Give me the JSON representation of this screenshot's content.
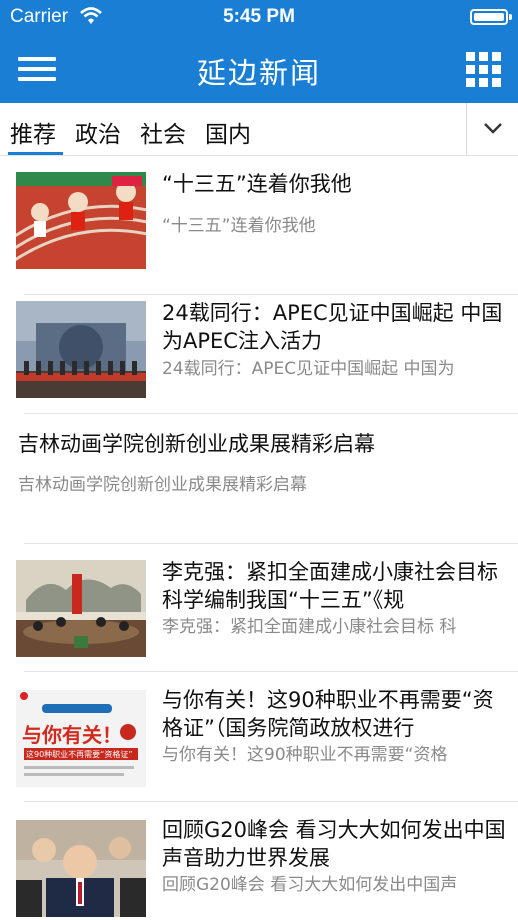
{
  "status_bar": {
    "carrier": "Carrier",
    "time": "5:45 PM",
    "battery_level": 1.0
  },
  "nav": {
    "title": "延边新闻",
    "menu_icon": "hamburger-menu-icon",
    "grid_icon": "app-grid-icon"
  },
  "tabs": [
    {
      "label": "推荐",
      "selected": true
    },
    {
      "label": "政治",
      "selected": false
    },
    {
      "label": "社会",
      "selected": false
    },
    {
      "label": "国内",
      "selected": false
    }
  ],
  "tabs_more_icon": "chevron-down-icon",
  "colors": {
    "brand": "#1a7fd4",
    "summary_text": "#8a8a8a"
  },
  "news": [
    {
      "headline": "“十三五”连着你我他",
      "summary": "“十三五”连着你我他",
      "has_image": true
    },
    {
      "headline": "24载同行：APEC见证中国崛起 中国为APEC注入活力",
      "summary": "24载同行：APEC见证中国崛起 中国为",
      "has_image": true
    },
    {
      "headline": "吉林动画学院创新创业成果展精彩启幕",
      "summary": "吉林动画学院创新创业成果展精彩启幕",
      "has_image": false
    },
    {
      "headline": "李克强：紧扣全面建成小康社会目标 科学编制我国“十三五”《规",
      "summary": "李克强：紧扣全面建成小康社会目标 科",
      "has_image": true
    },
    {
      "headline": "与你有关！这90种职业不再需要“资格证”（国务院简政放权进行",
      "summary": "与你有关！这90种职业不再需要“资格",
      "has_image": true,
      "image_text": {
        "title": "与你有关！",
        "sub": "这90种职业不再需要“资格证”"
      }
    },
    {
      "headline": "回顾G20峰会 看习大大如何发出中国声音助力世界发展",
      "summary": "回顾G20峰会 看习大大如何发出中国声",
      "has_image": true
    }
  ]
}
